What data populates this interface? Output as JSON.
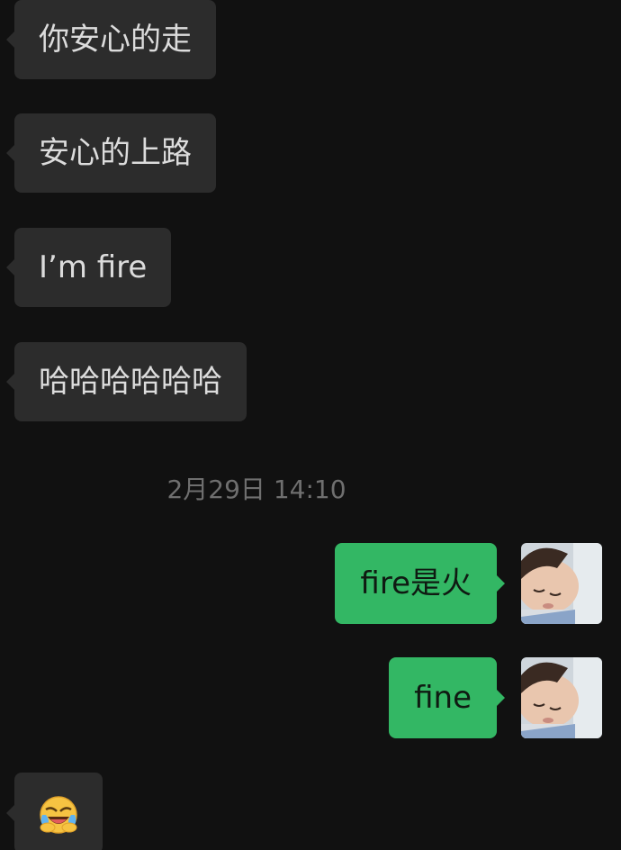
{
  "messages": {
    "incoming": [
      {
        "text": "你安心的走"
      },
      {
        "text": "安心的上路"
      },
      {
        "text": "I’m fire"
      },
      {
        "text": "哈哈哈哈哈哈"
      }
    ],
    "timestamp": "2月29日 14:10",
    "outgoing": [
      {
        "text": "fire是火"
      },
      {
        "text": "fine"
      }
    ],
    "last_incoming_emoji": "laughing-tears-emoji"
  },
  "colors": {
    "background": "#111111",
    "incoming_bubble": "#2c2c2c",
    "outgoing_bubble": "#33b764",
    "timestamp_text": "#6f6f6f"
  }
}
